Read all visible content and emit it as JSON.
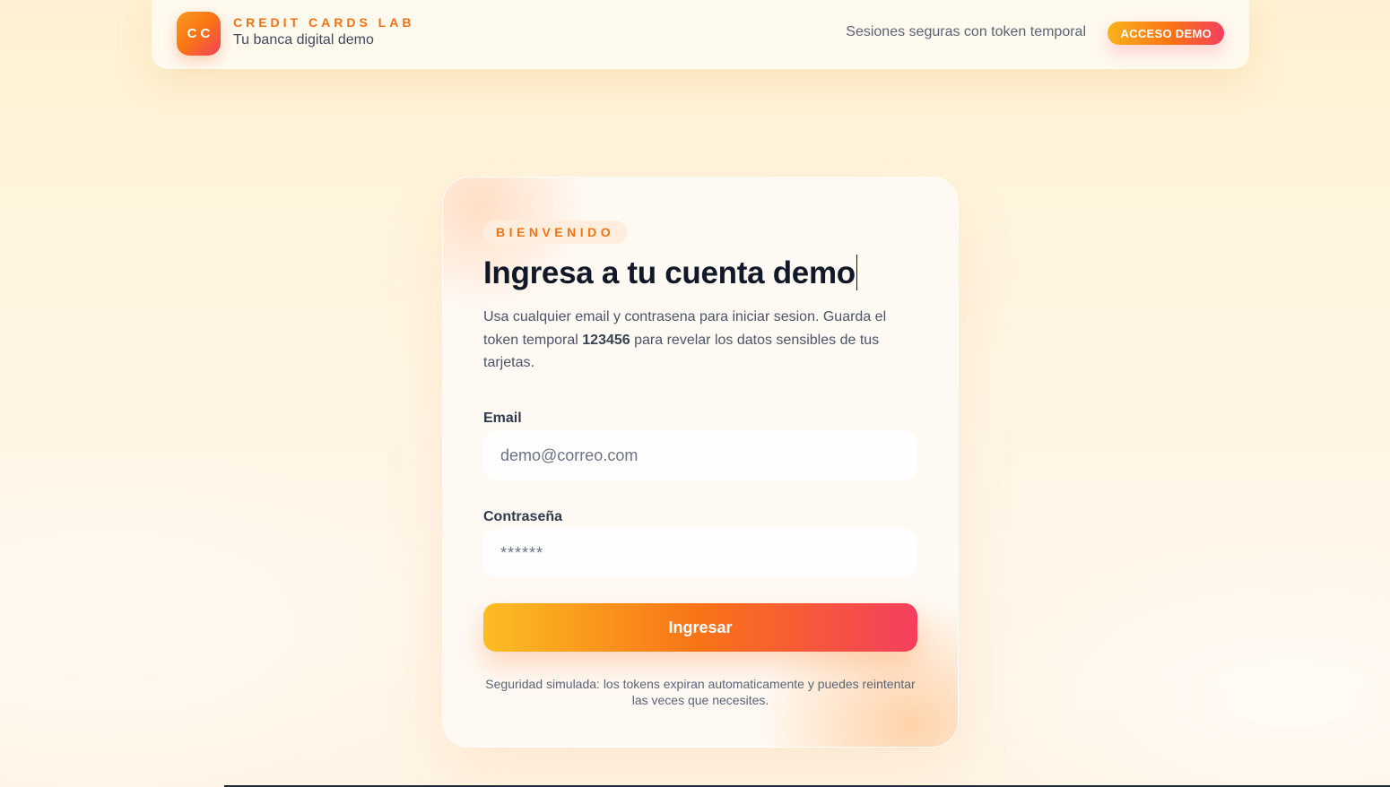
{
  "header": {
    "logo_text": "CC",
    "brand_name": "CREDIT CARDS LAB",
    "brand_subtitle": "Tu banca digital demo",
    "note": "Sesiones seguras con token temporal",
    "badge": "ACCESO DEMO"
  },
  "login": {
    "tag": "BIENVENIDO",
    "title": "Ingresa a tu cuenta demo",
    "description_before": "Usa cualquier email y contrasena para iniciar sesion. Guarda el token temporal ",
    "token": "123456",
    "description_after": " para revelar los datos sensibles de tus tarjetas.",
    "email_label": "Email",
    "email_value": "",
    "email_placeholder": "demo@correo.com",
    "password_label": "Contraseña",
    "password_value": "",
    "password_placeholder": "******",
    "submit_label": "Ingresar",
    "footnote": "Seguridad simulada: los tokens expiran automaticamente y puedes reintentar las veces que necesites."
  },
  "colors": {
    "accent_orange": "#f97316",
    "accent_yellow": "#fbbd24",
    "accent_rose": "#f43f5e",
    "title_text": "#111827"
  }
}
